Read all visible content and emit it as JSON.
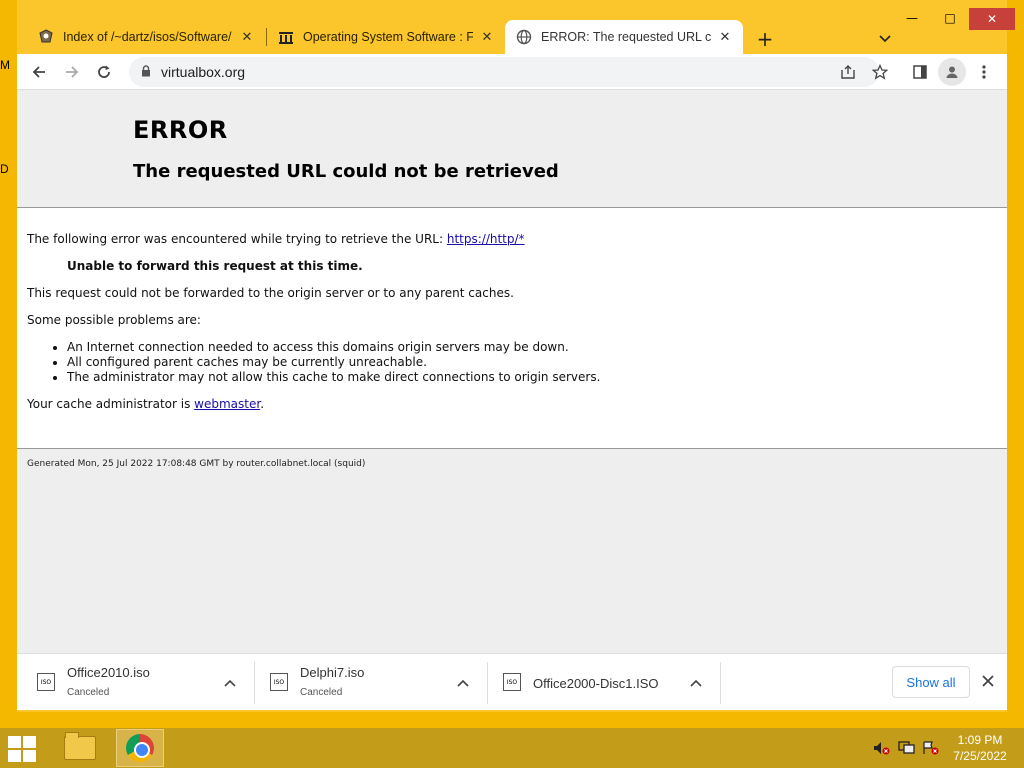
{
  "desktop": {
    "edge_glyph_top": "M",
    "edge_glyph_mid": "D"
  },
  "window": {
    "controls": {
      "minimize": "—",
      "maximize": "□",
      "close": "✕"
    }
  },
  "tabs": [
    {
      "title": "Index of /~dartz/isos/Software/",
      "icon": "favicon-icon"
    },
    {
      "title": "Operating System Software : Free",
      "icon": "archive-icon"
    },
    {
      "title": "ERROR: The requested URL could not",
      "icon": "globe-icon",
      "active": true
    }
  ],
  "toolbar": {
    "url": "virtualbox.org"
  },
  "page": {
    "error_title": "ERROR",
    "error_subtitle": "The requested URL could not be retrieved",
    "intro_text": "The following error was encountered while trying to retrieve the URL: ",
    "intro_link": "https://http/*",
    "unable_text": "Unable to forward this request at this time.",
    "forward_text": "This request could not be forwarded to the origin server or to any parent caches.",
    "problems_heading": "Some possible problems are:",
    "problems": [
      "An Internet connection needed to access this domains origin servers may be down.",
      "All configured parent caches may be currently unreachable.",
      "The administrator may not allow this cache to make direct connections to origin servers."
    ],
    "admin_text": "Your cache administrator is ",
    "admin_link": "webmaster",
    "admin_suffix": ".",
    "footer": "Generated Mon, 25 Jul 2022 17:08:48 GMT by router.collabnet.local (squid)"
  },
  "downloads": {
    "items": [
      {
        "name": "Office2010.iso",
        "status": "Canceled"
      },
      {
        "name": "Delphi7.iso",
        "status": "Canceled"
      },
      {
        "name": "Office2000-Disc1.ISO",
        "status": ""
      }
    ],
    "show_all": "Show all",
    "icon_label": "ISO"
  },
  "taskbar": {
    "time": "1:09 PM",
    "date": "7/25/2022"
  }
}
